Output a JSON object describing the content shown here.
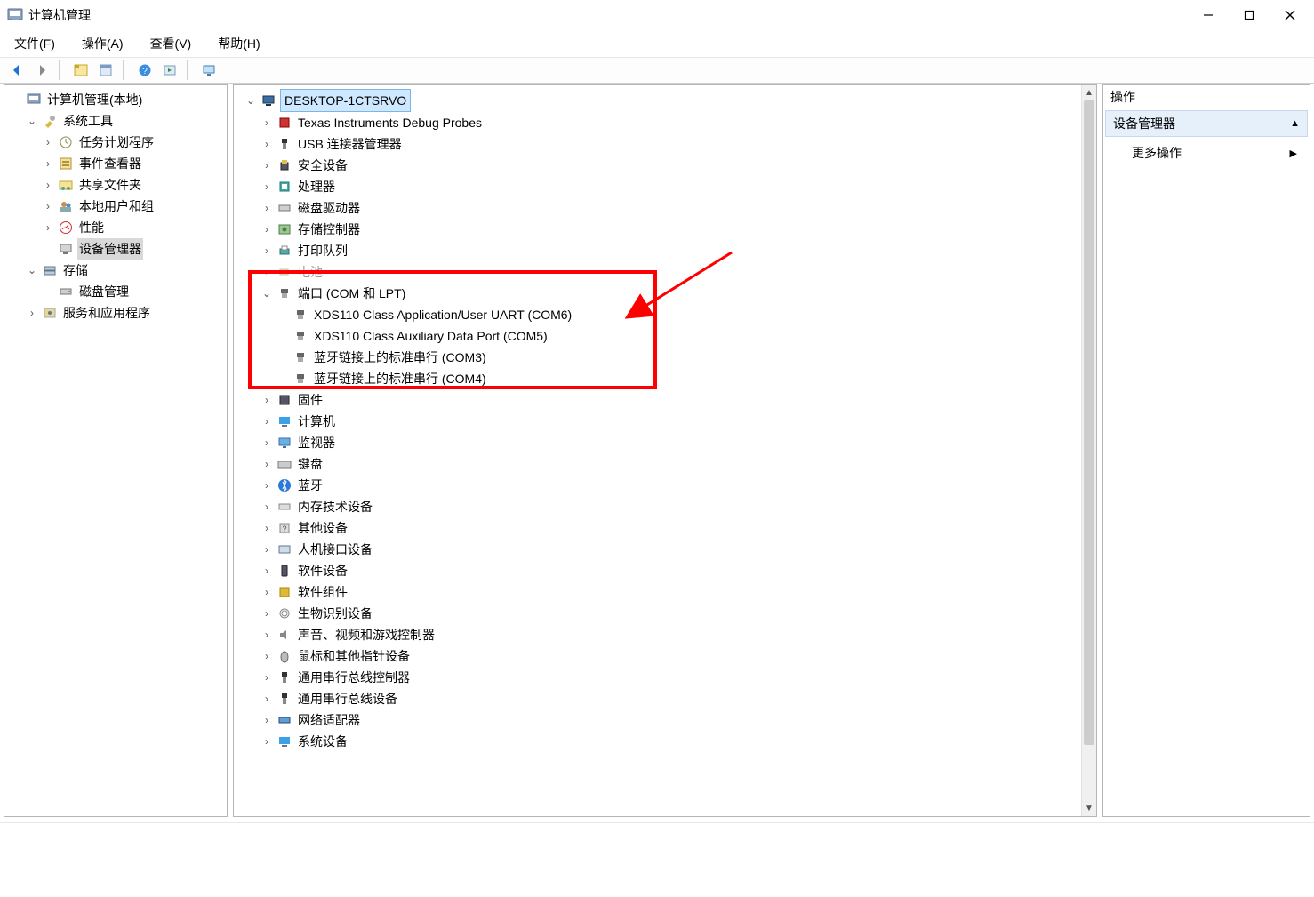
{
  "window": {
    "title": "计算机管理"
  },
  "menu": {
    "file": "文件(F)",
    "action": "操作(A)",
    "view": "查看(V)",
    "help": "帮助(H)"
  },
  "left_tree": {
    "root": "计算机管理(本地)",
    "system_tools": "系统工具",
    "task_scheduler": "任务计划程序",
    "event_viewer": "事件查看器",
    "shared_folders": "共享文件夹",
    "local_users": "本地用户和组",
    "performance": "性能",
    "device_manager": "设备管理器",
    "storage": "存储",
    "disk_management": "磁盘管理",
    "services_apps": "服务和应用程序"
  },
  "mid_tree": {
    "root": "DESKTOP-1CTSRVO",
    "categories": {
      "ti_debug": "Texas Instruments Debug Probes",
      "usb_conn_mgr": "USB 连接器管理器",
      "security_devices": "安全设备",
      "processors": "处理器",
      "disk_drives": "磁盘驱动器",
      "storage_controllers": "存储控制器",
      "print_queues": "打印队列",
      "batteries": "电池",
      "ports": "端口 (COM 和 LPT)",
      "port_items": {
        "xds_uart": "XDS110 Class Application/User UART (COM6)",
        "xds_aux": "XDS110 Class Auxiliary Data Port (COM5)",
        "bt_com3": "蓝牙链接上的标准串行 (COM3)",
        "bt_com4": "蓝牙链接上的标准串行 (COM4)"
      },
      "firmware": "固件",
      "computers": "计算机",
      "monitors": "监视器",
      "keyboards": "键盘",
      "bluetooth": "蓝牙",
      "memory_tech": "内存技术设备",
      "other_devices": "其他设备",
      "hid": "人机接口设备",
      "software_devices": "软件设备",
      "software_components": "软件组件",
      "biometric": "生物识别设备",
      "sound_video_game": "声音、视频和游戏控制器",
      "mice": "鼠标和其他指针设备",
      "usb_controllers": "通用串行总线控制器",
      "usb_devices": "通用串行总线设备",
      "network_adapters": "网络适配器",
      "system_devices": "系统设备"
    }
  },
  "right_pane": {
    "header": "操作",
    "group": "设备管理器",
    "more": "更多操作"
  }
}
